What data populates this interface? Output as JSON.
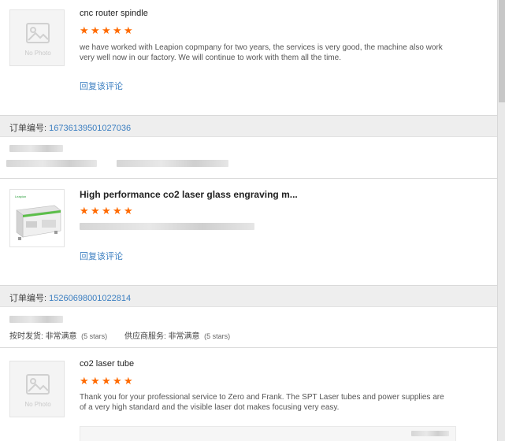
{
  "review1": {
    "product_title": "cnc router spindle",
    "nophoto": "No Photo",
    "review": "we have worked with Leapion copmpany for two years, the services is very good, the machine also work very well now in our factory. We will continue to work with them all the time.",
    "reply_link": "回复该评论"
  },
  "order1": {
    "label": "订单编号: ",
    "number": "16736139501027036"
  },
  "review2": {
    "product_title": "High performance co2 laser glass engraving m...",
    "reply_link": "回复该评论"
  },
  "order2": {
    "label": "订单编号: ",
    "number": "15260698001022814",
    "delivery_label": "按时发货: ",
    "delivery_value": "非常满意",
    "delivery_stars": "(5 stars)",
    "service_label": "供应商服务: ",
    "service_value": "非常满意",
    "service_stars": "(5 stars)"
  },
  "review3": {
    "product_title": "co2 laser tube",
    "nophoto": "No Photo",
    "review": "Thank you for your professional service to Zero and Frank. The SPT Laser tubes and power supplies are of a very high standard and the visible laser dot makes focusing very easy."
  },
  "colors": {
    "star": "#ff6a00",
    "link": "#3c7fc1",
    "order_bar": "#eeeeee"
  },
  "ratings": {
    "review1": 5,
    "review2": 5,
    "review3": 5
  }
}
